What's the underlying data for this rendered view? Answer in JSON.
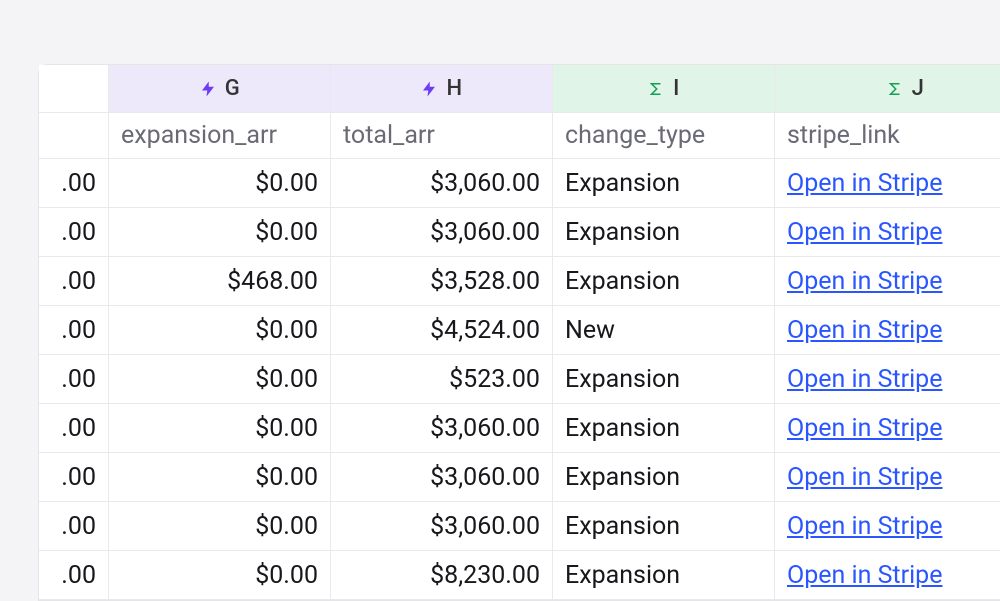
{
  "columns": {
    "g": {
      "letter": "G",
      "icon": "bolt",
      "header": "expansion_arr"
    },
    "h": {
      "letter": "H",
      "icon": "bolt",
      "header": "total_arr"
    },
    "i": {
      "letter": "I",
      "icon": "sigma",
      "header": "change_type"
    },
    "j": {
      "letter": "J",
      "icon": "sigma",
      "header": "stripe_link"
    }
  },
  "rows": [
    {
      "stub": ".00",
      "g": "$0.00",
      "h": "$3,060.00",
      "i": "Expansion",
      "j": "Open in Stripe"
    },
    {
      "stub": ".00",
      "g": "$0.00",
      "h": "$3,060.00",
      "i": "Expansion",
      "j": "Open in Stripe"
    },
    {
      "stub": ".00",
      "g": "$468.00",
      "h": "$3,528.00",
      "i": "Expansion",
      "j": "Open in Stripe"
    },
    {
      "stub": ".00",
      "g": "$0.00",
      "h": "$4,524.00",
      "i": "New",
      "j": "Open in Stripe"
    },
    {
      "stub": ".00",
      "g": "$0.00",
      "h": "$523.00",
      "i": "Expansion",
      "j": "Open in Stripe"
    },
    {
      "stub": ".00",
      "g": "$0.00",
      "h": "$3,060.00",
      "i": "Expansion",
      "j": "Open in Stripe"
    },
    {
      "stub": ".00",
      "g": "$0.00",
      "h": "$3,060.00",
      "i": "Expansion",
      "j": "Open in Stripe"
    },
    {
      "stub": ".00",
      "g": "$0.00",
      "h": "$3,060.00",
      "i": "Expansion",
      "j": "Open in Stripe"
    },
    {
      "stub": ".00",
      "g": "$0.00",
      "h": "$8,230.00",
      "i": "Expansion",
      "j": "Open in Stripe"
    }
  ]
}
